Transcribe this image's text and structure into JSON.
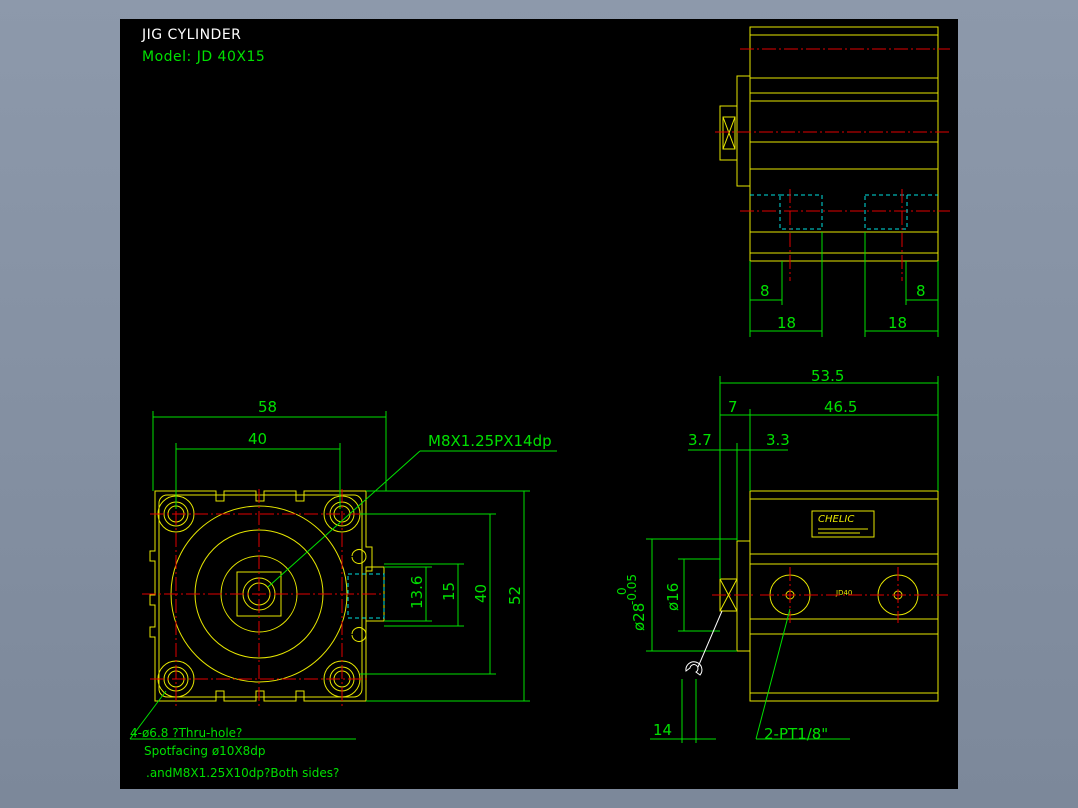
{
  "title": "JIG CYLINDER",
  "model": "Model: JD 40X15",
  "front_view": {
    "width_overall": "58",
    "width_holes": "40",
    "thread_callout": "M8X1.25PX14dp",
    "dim_13_6": "13.6",
    "dim_15": "15",
    "dim_40": "40",
    "dim_52": "52",
    "note_line1": "4-ø6.8 ?Thru-hole?",
    "note_line2": "Spotfacing ø10X8dp",
    "note_line3": ".andM8X1.25X10dp?Both sides?"
  },
  "top_view": {
    "dim_8_left": "8",
    "dim_8_right": "8",
    "dim_18_left": "18",
    "dim_18_right": "18"
  },
  "side_view": {
    "length_overall": "53.5",
    "dim_7": "7",
    "dim_46_5": "46.5",
    "dim_3_7": "3.7",
    "dim_3_3": "3.3",
    "dia_28": "ø28",
    "tol_upper": "0",
    "tol_lower": "-0.05",
    "dia_16": "ø16",
    "dim_14": "14",
    "port_callout": "2-PT1/8\"",
    "brand": "CHELIC",
    "plate_code": "JD40"
  },
  "colors": {
    "background": "#000000",
    "dimension": "#00e000",
    "outline": "#e6e600",
    "centerline": "#e00000",
    "hidden": "#00e0e0",
    "frame": "#8d99ab"
  }
}
